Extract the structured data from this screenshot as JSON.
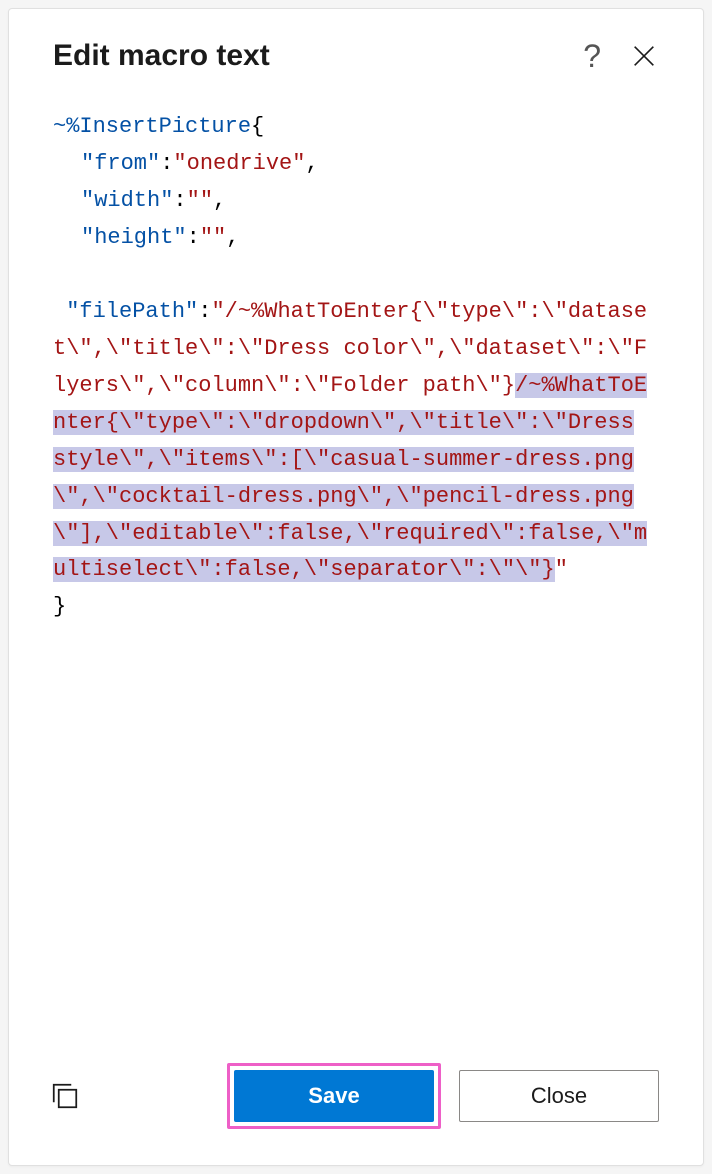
{
  "dialog": {
    "title": "Edit macro text",
    "help_symbol": "?"
  },
  "code": {
    "macro_open": "~%InsertPicture",
    "brace_open": "{",
    "brace_close": "}",
    "comma": ",",
    "colon": ":",
    "key_from": "\"from\"",
    "val_from": "\"onedrive\"",
    "key_width": "\"width\"",
    "val_width": "\"\"",
    "key_height": "\"height\"",
    "val_height": "\"\"",
    "key_filepath": "\"filePath\"",
    "fp_start": "\"/~%WhatToEnter{\\\"type\\\":\\\"dataset\\\",\\\"title\\\":\\\"Dress color\\\",\\\"dataset\\\":\\\"Flyers\\\",\\\"column\\\":\\\"Folder path\\\"}",
    "fp_sel": "/~%WhatToEnter{\\\"type\\\":\\\"dropdown\\\",\\\"title\\\":\\\"Dress style\\\",\\\"items\\\":[\\\"casual-summer-dress.png\\\",\\\"cocktail-dress.png\\\",\\\"pencil-dress.png\\\"],\\\"editable\\\":false,\\\"required\\\":false,\\\"multiselect\\\":false,\\\"separator\\\":\\\"\\\"}",
    "fp_close": "\""
  },
  "footer": {
    "save_label": "Save",
    "close_label": "Close"
  }
}
